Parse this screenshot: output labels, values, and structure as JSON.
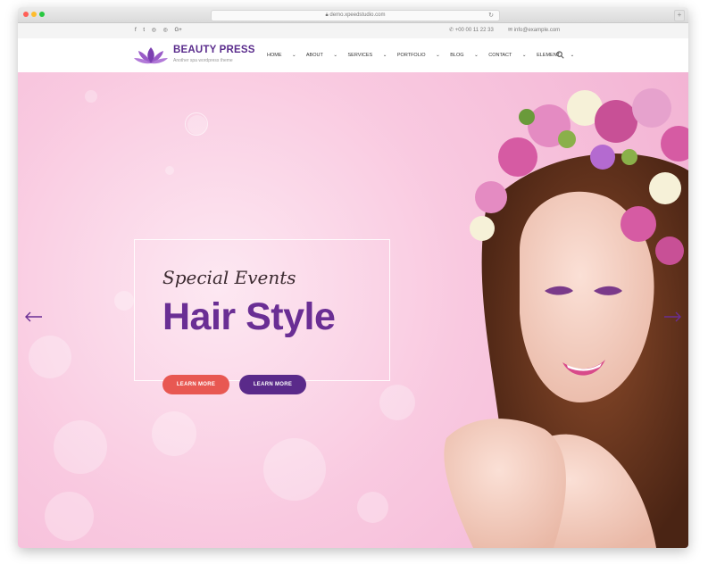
{
  "browser": {
    "url": "demo.xpeedstudio.com",
    "lock_icon": "lock-icon",
    "reload_icon": "reload-icon",
    "new_tab_icon": "plus-icon"
  },
  "topbar": {
    "social": [
      "f",
      "t",
      "◎",
      "◎",
      "G+"
    ],
    "phone": "+00 00 11 22 33",
    "email": "info@example.com"
  },
  "header": {
    "brand": "BEAUTY PRESS",
    "tagline": "Another spa wordpress theme",
    "nav": [
      "HOME",
      "ABOUT",
      "SERVICES",
      "PORTFOLIO",
      "BLOG",
      "CONTACT",
      "ELEMENT"
    ],
    "search_icon": "search-icon"
  },
  "hero": {
    "kicker": "Special Events",
    "headline": "Hair Style",
    "button_primary": "LEARN MORE",
    "button_secondary": "LEARN MORE"
  },
  "colors": {
    "brand_purple": "#5a2c8c",
    "headline_purple": "#6a2e94",
    "button_coral": "#e85852",
    "button_purple": "#5a2a8a",
    "hero_pink": "#f9c9e0"
  }
}
